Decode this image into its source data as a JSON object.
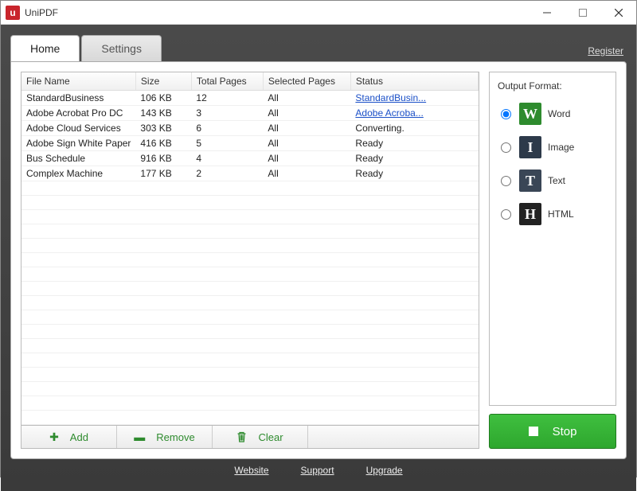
{
  "titlebar": {
    "title": "UniPDF",
    "icon_letter": "u"
  },
  "tabs": {
    "home": "Home",
    "settings": "Settings",
    "register": "Register"
  },
  "table": {
    "headers": {
      "name": "File Name",
      "size": "Size",
      "pages": "Total Pages",
      "selected": "Selected Pages",
      "status": "Status"
    },
    "rows": [
      {
        "name": "StandardBusiness",
        "size": "106 KB",
        "pages": "12",
        "selected": "All",
        "status": "StandardBusin...",
        "status_link": true
      },
      {
        "name": "Adobe Acrobat Pro DC",
        "size": "143 KB",
        "pages": "3",
        "selected": "All",
        "status": "Adobe Acroba...",
        "status_link": true
      },
      {
        "name": "Adobe Cloud Services",
        "size": "303 KB",
        "pages": "6",
        "selected": "All",
        "status": "Converting.",
        "status_link": false
      },
      {
        "name": "Adobe Sign White Paper",
        "size": "416 KB",
        "pages": "5",
        "selected": "All",
        "status": "Ready",
        "status_link": false
      },
      {
        "name": "Bus Schedule",
        "size": "916 KB",
        "pages": "4",
        "selected": "All",
        "status": "Ready",
        "status_link": false
      },
      {
        "name": "Complex Machine",
        "size": "177 KB",
        "pages": "2",
        "selected": "All",
        "status": "Ready",
        "status_link": false
      }
    ]
  },
  "buttons": {
    "add": "Add",
    "remove": "Remove",
    "clear": "Clear"
  },
  "output": {
    "title": "Output Format:",
    "options": {
      "word": "Word",
      "image": "Image",
      "text": "Text",
      "html": "HTML"
    },
    "selected": "word",
    "glyphs": {
      "word": "W",
      "image": "I",
      "text": "T",
      "html": "H"
    }
  },
  "stop": "Stop",
  "footer": {
    "website": "Website",
    "support": "Support",
    "upgrade": "Upgrade"
  }
}
